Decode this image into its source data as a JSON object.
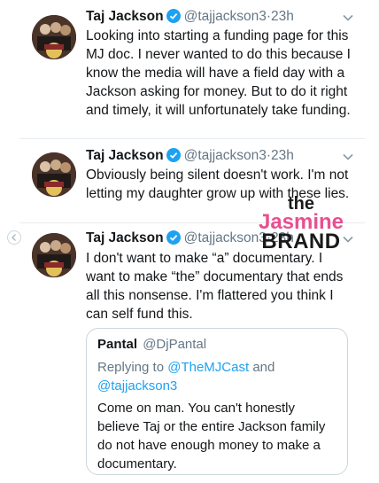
{
  "tweets": [
    {
      "name": "Taj Jackson",
      "handle": "@tajjackson3",
      "dot": "·",
      "time": "23h",
      "text": "Looking into starting a funding page for this MJ doc. I never wanted to do this because I know the media will have a field day with a Jackson asking for money. But to do it right and timely, it will unfortunately take funding."
    },
    {
      "name": "Taj Jackson",
      "handle": "@tajjackson3",
      "dot": "·",
      "time": "23h",
      "text": "Obviously being silent doesn't work. I'm not letting my daughter grow up with these lies."
    },
    {
      "name": "Taj Jackson",
      "handle": "@tajjackson3",
      "dot": "·",
      "time": "23h",
      "text": "I don't want to make “a” documentary. I want to make “the” documentary that ends all this nonsense. I'm flattered you think I can self fund this."
    }
  ],
  "quoted_tweet": {
    "name": "Pantal",
    "handle": "@DjPantal",
    "replying_prefix": "Replying to",
    "reply_to_1": "@TheMJCast",
    "reply_and": "and",
    "reply_to_2": "@tajjackson3",
    "text": "Come on man. You can't honestly believe Taj or the entire Jackson family do not have enough money to make a documentary."
  },
  "watermark": {
    "line1": "the",
    "line2": "Jasmine",
    "line3": "BRAND"
  },
  "colors": {
    "verified": "#1da1f2",
    "link": "#1da1f2",
    "muted": "#657786",
    "watermark_pink": "#e8508f"
  },
  "icons": {
    "verified": "verified-badge-icon",
    "caret": "chevron-down-icon",
    "thread": "thread-connector-icon"
  }
}
